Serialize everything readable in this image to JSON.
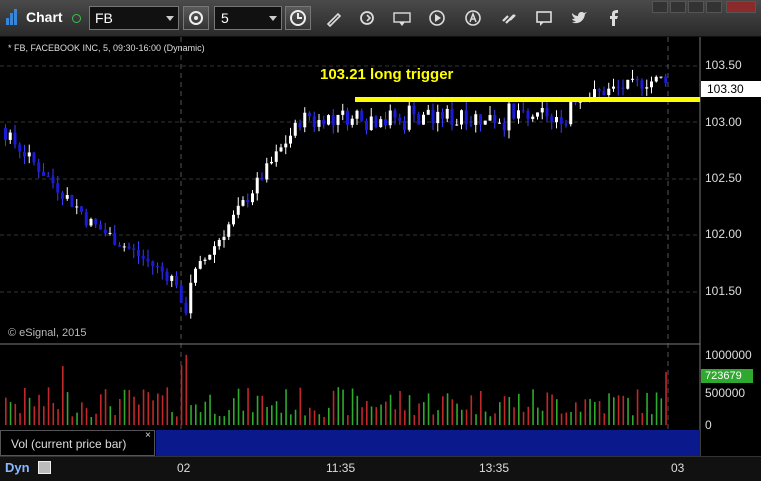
{
  "toolbar": {
    "title": "Chart",
    "symbol": "FB",
    "interval": "5"
  },
  "chart": {
    "legend": "* FB, FACEBOOK INC, 5, 09:30-16:00 (Dynamic)",
    "copyright": "© eSignal, 2015",
    "annotation": "103.21 long trigger",
    "last_price": "103.30",
    "trigger_price": 103.21,
    "price_labels": [
      "103.50",
      "103.00",
      "102.50",
      "102.00",
      "101.50"
    ],
    "volume_labels": [
      "1000000",
      "500000",
      "0"
    ],
    "current_volume": "723679",
    "study_label": "Vol (current price bar)",
    "study_close": "×",
    "x_labels": [
      "02",
      "11:35",
      "13:35",
      "03"
    ],
    "status_label": "Dyn"
  },
  "colors": {
    "up": "#ffffff",
    "down": "#1a1ad8",
    "trigger": "#ffff00",
    "vol_up": "#2faa2f",
    "vol_down": "#c0282a",
    "grid": "#3a3a3a"
  }
}
